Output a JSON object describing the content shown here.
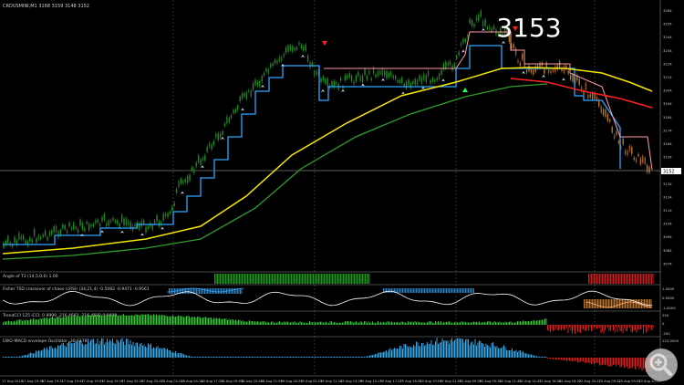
{
  "window": {
    "title": "CRDUSMINI,M1 3168 3159 3148 3152"
  },
  "price_overlay": "3153",
  "price_tag": "3152",
  "price_axis_labels": [
    "3264",
    "3254",
    "3244",
    "3234",
    "3224",
    "3214",
    "3204",
    "3194",
    "3184",
    "3174",
    "3164",
    "3154",
    "3144",
    "3134",
    "3124",
    "3114",
    "3104",
    "3094",
    "3084",
    "3074"
  ],
  "indicators": [
    {
      "label": "Angle of T3 (14,5,0.6) 1.00"
    },
    {
      "label": "Fisher TSD crossover of chaos (cRSI) (34,21,4) -0.5082 -0.9471 -0.9561"
    },
    {
      "label": "TrendCCI 125 iCCI: 0.9999 -216.4682 -216.4682 0.9999"
    },
    {
      "label": "EWO-MACD envelope Oscillator -30.6178"
    }
  ],
  "sub_axis_labels": {
    "angle": "",
    "fisher": [
      "1.0000",
      "0.0000",
      "-1.0000"
    ],
    "cci": [
      "250",
      "0",
      "-250"
    ],
    "ewo": [
      "123.0000",
      "0.0000"
    ]
  },
  "time_axis_labels": [
    "17 Aug 2016",
    "17 Aug 19:38",
    "17 Aug 19:31",
    "17 Aug 19:47",
    "17 Aug 19:03",
    "17 Aug 19:19",
    "17 Aug 20:29",
    "17 Aug 20:47",
    "18 Aug 01:02",
    "18 Aug 04:14",
    "18 Aug 17:22",
    "18 Aug 19:03",
    "18 Aug 20:43",
    "18 Aug 21:59",
    "19 Aug 00:25",
    "19 Aug 02:29",
    "19 Aug 11:14",
    "19 Aug 13:29",
    "19 Aug 15:13",
    "19 Aug 17:27",
    "19 Aug 18:35",
    "19 Aug 19:53",
    "19 Aug 21:55",
    "22 Aug 09:59",
    "22 Aug 09:39",
    "22 Aug 11:49",
    "22 Aug 14:47",
    "22 Aug 16:04",
    "22 Aug 18:32",
    "22 Aug 20:17",
    "23 Aug 09:32",
    "23 Aug 09:51",
    "23 Aug 10:51"
  ],
  "colors": {
    "background": "#000000",
    "bull_candle": "#1f8f1f",
    "bear_candle": "#cc3333",
    "stop_blue": "#2ea6ff",
    "stop_pink": "#ff9aa8",
    "ma_yellow": "#f5e600",
    "ma_red": "#ff2020",
    "ma_green": "#2e9e2e",
    "grid": "#4a4a4a",
    "zoom": "#bdbdbd"
  },
  "icons": {
    "zoom": "magnifier-plus-icon"
  }
}
